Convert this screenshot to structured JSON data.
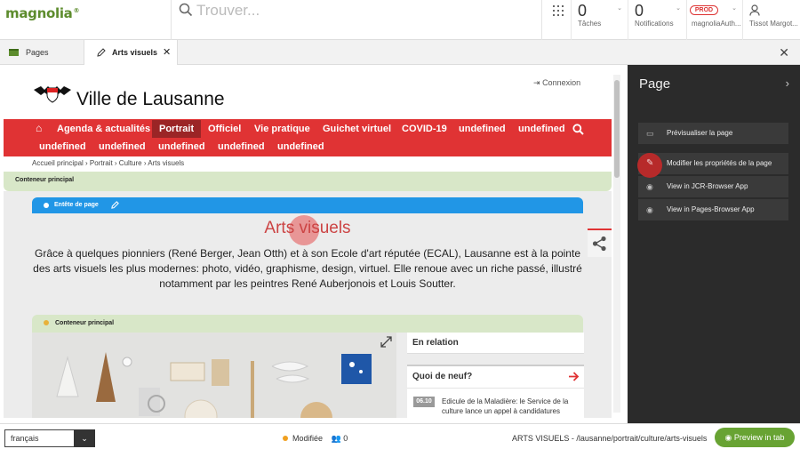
{
  "app": {
    "logo": "magnolia"
  },
  "topbar": {
    "search_placeholder": "Trouver...",
    "tasks": {
      "count": "0",
      "label": "Tâches"
    },
    "notifications": {
      "count": "0",
      "label": "Notifications"
    },
    "instance": {
      "badge": "PROD",
      "label": "magnoliaAuth..."
    },
    "user": {
      "label": "Tissot Margot..."
    }
  },
  "tabs": [
    {
      "label": "Pages"
    },
    {
      "label": "Arts visuels"
    }
  ],
  "site": {
    "city": "Ville de Lausanne",
    "login": "Connexion",
    "nav": [
      "Agenda & actualités",
      "Portrait",
      "Officiel",
      "Vie pratique",
      "Guichet virtuel",
      "COVID-19",
      "undefined",
      "undefined",
      "undefined",
      "undefined",
      "undefined",
      "undefined",
      "undefined"
    ],
    "breadcrumb": "Accueil principal › Portrait › Culture › Arts visuels",
    "container_label": "Conteneur principal",
    "header_label": "Entête de page",
    "title": "Arts visuels",
    "lead": "Grâce à quelques pionniers (René Berger, Jean Otth) et à son Ecole d'art réputée (ECAL), Lausanne est à la pointe des arts visuels les plus modernes: photo, vidéo, graphisme, design, virtuel. Elle renoue avec un riche passé, illustré notamment par les peintres René Auberjonois et Louis Soutter.",
    "container2_label": "Conteneur principal",
    "related": "En relation",
    "news_title": "Quoi de neuf?",
    "news_item": {
      "date": "06.10",
      "text": "Edicule de la Maladière: le Service de la culture lance un appel à candidatures"
    }
  },
  "panel": {
    "title": "Page",
    "actions": [
      {
        "label": "Prévisualiser la page",
        "icon": "tag-icon"
      },
      {
        "label": "Modifier les propriétés de la page",
        "icon": "pencil-icon"
      },
      {
        "label": "View in JCR-Browser App",
        "icon": "eye-icon"
      },
      {
        "label": "View in Pages-Browser App",
        "icon": "eye-icon"
      }
    ]
  },
  "footer": {
    "language": "français",
    "status": "Modifiée",
    "users": "0",
    "path": "ARTS VISUELS - /lausanne/portrait/culture/arts-visuels",
    "preview": "Preview in tab"
  },
  "colors": {
    "brand_green": "#5d8c2d",
    "nav_red": "#e03334",
    "header_blue": "#2196e6",
    "panel_dark": "#2b2b2b"
  }
}
